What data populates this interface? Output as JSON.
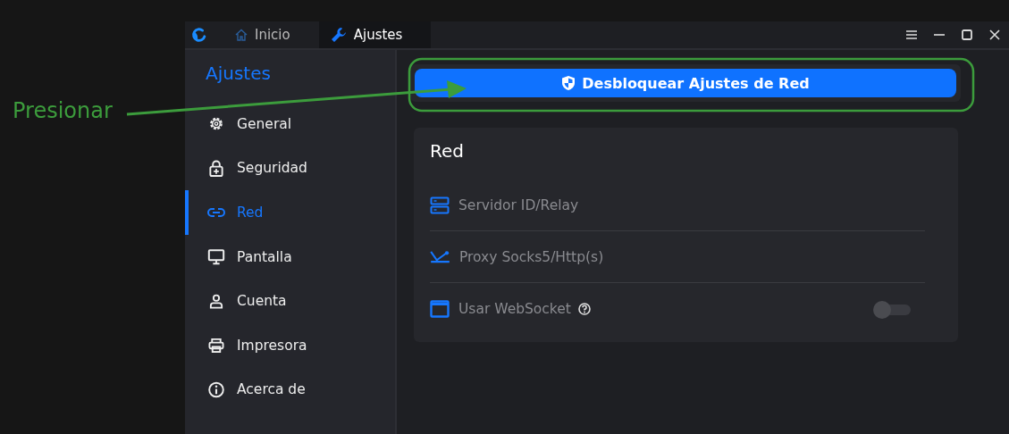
{
  "annotation": {
    "label": "Presionar"
  },
  "title_bar": {
    "tabs": [
      {
        "label": "Inicio",
        "selected": false
      },
      {
        "label": "Ajustes",
        "selected": true
      }
    ]
  },
  "sidebar": {
    "title": "Ajustes",
    "items": [
      {
        "label": "General",
        "selected": false
      },
      {
        "label": "Seguridad",
        "selected": false
      },
      {
        "label": "Red",
        "selected": true
      },
      {
        "label": "Pantalla",
        "selected": false
      },
      {
        "label": "Cuenta",
        "selected": false
      },
      {
        "label": "Impresora",
        "selected": false
      },
      {
        "label": "Acerca de",
        "selected": false
      }
    ]
  },
  "unlock_button": {
    "label": "Desbloquear Ajustes de Red"
  },
  "section": {
    "title": "Red",
    "rows": [
      {
        "kind": "link",
        "label": "Servidor ID/Relay",
        "disabled": true
      },
      {
        "kind": "link",
        "label": "Proxy Socks5/Http(s)",
        "disabled": true
      },
      {
        "kind": "toggle",
        "label": "Usar WebSocket",
        "on": false,
        "disabled": true
      }
    ]
  }
}
